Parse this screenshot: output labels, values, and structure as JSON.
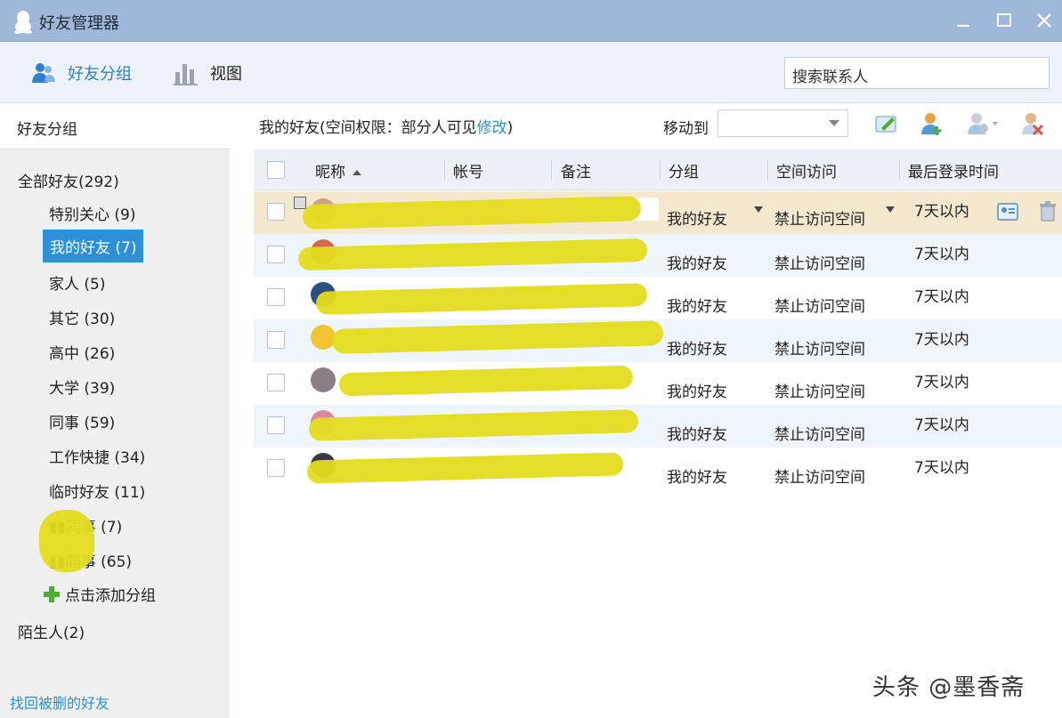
{
  "window": {
    "title": "好友管理器"
  },
  "toolbar": {
    "tab_groups": "好友分组",
    "tab_view": "视图",
    "search_placeholder": "搜索联系人"
  },
  "sidebar": {
    "header": "好友分组",
    "all_friends": "全部好友(292)",
    "groups": [
      "特别关心 (9)",
      "我的好友 (7)",
      "家人 (5)",
      "其它 (30)",
      "高中 (26)",
      "大学 (39)",
      "同事 (59)",
      "工作快捷 (34)",
      "临时好友 (11)",
      "同事 (7)",
      "同事 (65)"
    ],
    "add_group": "点击添加分组",
    "strangers": "陌生人(2)",
    "recover": "找回被删的好友"
  },
  "main": {
    "info_prefix": "我的好友(空间权限：部分人可见",
    "info_link": "修改",
    "info_suffix": ")",
    "move_to": "移动到",
    "columns": [
      "昵称",
      "帐号",
      "备注",
      "分组",
      "空间访问",
      "最后登录时间"
    ],
    "rows": [
      {
        "group": "我的好友",
        "space": "禁止访问空间",
        "last_login": "7天以内"
      },
      {
        "group": "我的好友",
        "space": "禁止访问空间",
        "last_login": "7天以内"
      },
      {
        "group": "我的好友",
        "space": "禁止访问空间",
        "last_login": "7天以内"
      },
      {
        "group": "我的好友",
        "space": "禁止访问空间",
        "last_login": "7天以内"
      },
      {
        "group": "我的好友",
        "space": "禁止访问空间",
        "last_login": "7天以内"
      },
      {
        "group": "我的好友",
        "space": "禁止访问空间",
        "last_login": "7天以内"
      },
      {
        "group": "我的好友",
        "space": "禁止访问空间",
        "last_login": "7天以内"
      }
    ]
  },
  "watermark": "头条 @墨香斋",
  "colors": {
    "titlebar": "#9fb8d9",
    "accent": "#2e8fd9",
    "link": "#2a8fd6",
    "selected_row": "#f4e9cf",
    "alt_row": "#eef5fb",
    "redaction": "#e4dc1d"
  }
}
